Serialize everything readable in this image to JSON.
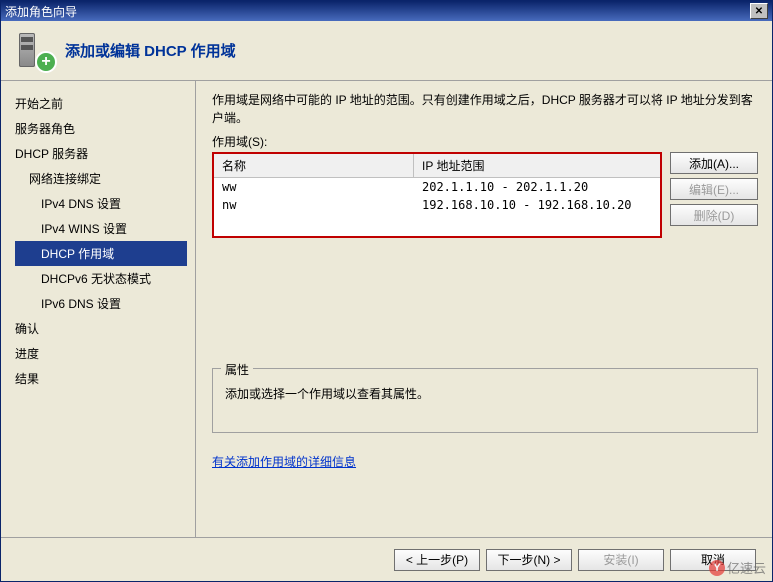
{
  "titlebar": {
    "title": "添加角色向导"
  },
  "header": {
    "title": "添加或编辑 DHCP 作用域"
  },
  "sidebar": {
    "items": [
      {
        "label": "开始之前",
        "indent": 0
      },
      {
        "label": "服务器角色",
        "indent": 0
      },
      {
        "label": "DHCP 服务器",
        "indent": 0
      },
      {
        "label": "网络连接绑定",
        "indent": 1
      },
      {
        "label": "IPv4 DNS 设置",
        "indent": 2
      },
      {
        "label": "IPv4 WINS 设置",
        "indent": 2
      },
      {
        "label": "DHCP 作用域",
        "indent": 2,
        "selected": true
      },
      {
        "label": "DHCPv6 无状态模式",
        "indent": 2
      },
      {
        "label": "IPv6 DNS 设置",
        "indent": 2
      },
      {
        "label": "确认",
        "indent": 0
      },
      {
        "label": "进度",
        "indent": 0
      },
      {
        "label": "结果",
        "indent": 0
      }
    ]
  },
  "main": {
    "description": "作用域是网络中可能的 IP 地址的范围。只有创建作用域之后，DHCP 服务器才可以将 IP 地址分发到客户端。",
    "scopes_label": "作用域(S):",
    "table": {
      "headers": {
        "name": "名称",
        "range": "IP 地址范围"
      },
      "rows": [
        {
          "name": "ww",
          "range": "202.1.1.10 - 202.1.1.20"
        },
        {
          "name": "nw",
          "range": "192.168.10.10 - 192.168.10.20"
        }
      ]
    },
    "buttons": {
      "add": "添加(A)...",
      "edit": "编辑(E)...",
      "delete": "删除(D)"
    },
    "properties": {
      "legend": "属性",
      "hint": "添加或选择一个作用域以查看其属性。"
    },
    "help_link": "有关添加作用域的详细信息"
  },
  "footer": {
    "prev": "< 上一步(P)",
    "next": "下一步(N) >",
    "install": "安装(I)",
    "cancel": "取消"
  },
  "watermark": {
    "text": "亿速云"
  }
}
